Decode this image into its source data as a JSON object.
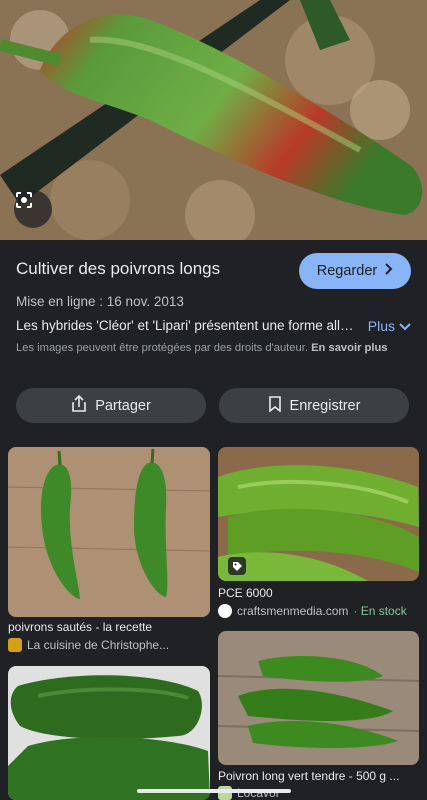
{
  "detail": {
    "title": "Cultiver des poivrons longs",
    "visit_label": "Regarder",
    "date": "Mise en ligne : 16 nov. 2013",
    "description": "Les hybrides 'Cléor' et 'Lipari' présentent une forme allongée",
    "more_label": "Plus",
    "copyright": "Les images peuvent être protégées par des droits d'auteur.",
    "learn_more": "En savoir plus",
    "share_label": "Partager",
    "save_label": "Enregistrer"
  },
  "results": [
    {
      "caption": "poivrons sautés - la recette",
      "source": "La cuisine de Christophe..."
    },
    {
      "caption": "PCE 6000",
      "source": "craftsmenmedia.com",
      "stock": "· En stock"
    },
    {
      "caption": "Poivron long vert tendre - 500 g ...",
      "source": "Locavor"
    }
  ],
  "icons": {
    "lens": "lens-icon",
    "visit": "chevron-right-icon",
    "more": "chevron-down-icon",
    "share": "share-icon",
    "save": "bookmark-icon",
    "tag": "tag-icon"
  },
  "colors": {
    "accent": "#8ab4f8",
    "background": "#202124",
    "stock": "#81c995"
  }
}
